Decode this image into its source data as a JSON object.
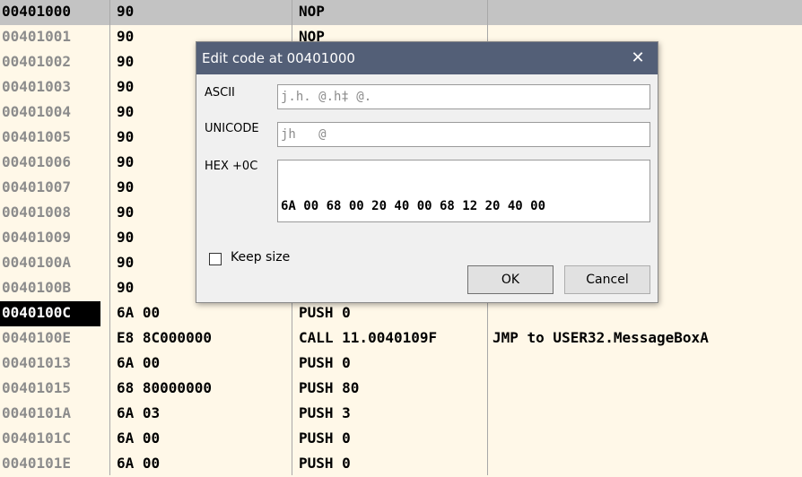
{
  "listing": {
    "rows": [
      {
        "addr": "00401000",
        "hex": "90",
        "dis": "NOP",
        "comment": ""
      },
      {
        "addr": "00401001",
        "hex": "90",
        "dis": "NOP",
        "comment": ""
      },
      {
        "addr": "00401002",
        "hex": "90",
        "dis": "",
        "comment": ""
      },
      {
        "addr": "00401003",
        "hex": "90",
        "dis": "",
        "comment": ""
      },
      {
        "addr": "00401004",
        "hex": "90",
        "dis": "",
        "comment": ""
      },
      {
        "addr": "00401005",
        "hex": "90",
        "dis": "",
        "comment": ""
      },
      {
        "addr": "00401006",
        "hex": "90",
        "dis": "",
        "comment": ""
      },
      {
        "addr": "00401007",
        "hex": "90",
        "dis": "",
        "comment": ""
      },
      {
        "addr": "00401008",
        "hex": "90",
        "dis": "",
        "comment": ""
      },
      {
        "addr": "00401009",
        "hex": "90",
        "dis": "",
        "comment": ""
      },
      {
        "addr": "0040100A",
        "hex": "90",
        "dis": "",
        "comment": ""
      },
      {
        "addr": "0040100B",
        "hex": "90",
        "dis": "",
        "comment": ""
      },
      {
        "addr": "0040100C",
        "hex": "6A 00",
        "dis": "PUSH 0",
        "comment": ""
      },
      {
        "addr": "0040100E",
        "hex": "E8 8C000000",
        "dis": "CALL 11.0040109F",
        "comment": "JMP to USER32.MessageBoxA"
      },
      {
        "addr": "00401013",
        "hex": "6A 00",
        "dis": "PUSH 0",
        "comment": ""
      },
      {
        "addr": "00401015",
        "hex": "68 80000000",
        "dis": "PUSH 80",
        "comment": ""
      },
      {
        "addr": "0040101A",
        "hex": "6A 03",
        "dis": "PUSH 3",
        "comment": ""
      },
      {
        "addr": "0040101C",
        "hex": "6A 00",
        "dis": "PUSH 0",
        "comment": ""
      },
      {
        "addr": "0040101E",
        "hex": "6A 00",
        "dis": "PUSH 0",
        "comment": ""
      }
    ]
  },
  "dialog": {
    "title": "Edit code at 00401000",
    "close_glyph": "✕",
    "ascii_label": "ASCII",
    "ascii_value": "j.h. @.h‡ @.",
    "unicode_label": "UNICODE",
    "unicode_value": "jh   @",
    "hex_label": "HEX +0C",
    "hex_value": "6A 00 68 00 20 40 00 68 12 20 40 00",
    "keep_size_label": "Keep size",
    "ok_label": "OK",
    "cancel_label": "Cancel"
  }
}
